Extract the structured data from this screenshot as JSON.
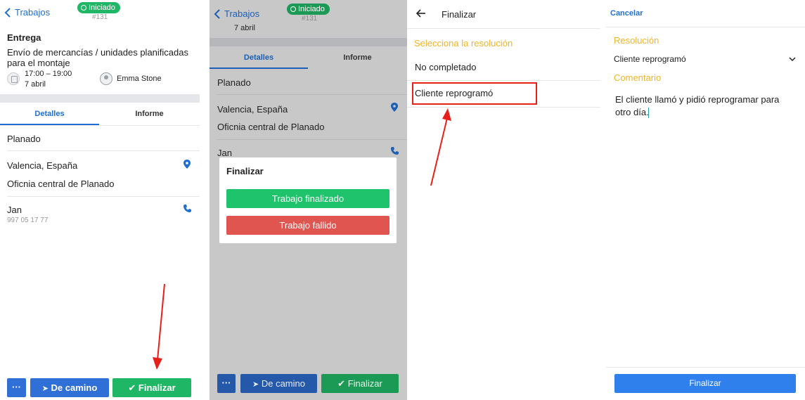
{
  "screen1": {
    "back_label": "Trabajos",
    "status_badge": "Iniciado",
    "job_number": "#131",
    "type_heading": "Entrega",
    "description_line1": "Envío de mercancías / unidades planificadas",
    "description_line2": "para el montaje",
    "time_range": "17:00 – 19:00",
    "date": "7 abril",
    "assignee": "Emma Stone",
    "tabs": [
      {
        "label": "Detalles"
      },
      {
        "label": "Informe"
      }
    ],
    "customer": "Planado",
    "address_city": "Valencia, España",
    "address_place": "Oficnia central de Planado",
    "contact_name": "Jan",
    "contact_phone": "997 05 17 77",
    "buttons": {
      "more": "···",
      "on_the_way": "De camino",
      "finish": "Finalizar"
    },
    "colors": {
      "accent": "#1f6fd1",
      "success": "#1fb765",
      "danger": "#e0554f",
      "annotation": "#e8201a"
    }
  },
  "screen2": {
    "back_label": "Trabajos",
    "status_badge": "Iniciado",
    "job_number": "#131",
    "date_partial": "7 abril",
    "tabs": [
      {
        "label": "Detalles"
      },
      {
        "label": "Informe"
      }
    ],
    "customer": "Planado",
    "address_city": "Valencia, España",
    "address_place": "Oficnia central de Planado",
    "contact_name": "Jan",
    "dialog": {
      "title": "Finalizar",
      "success_button": "Trabajo finalizado",
      "fail_button": "Trabajo fallido"
    },
    "buttons": {
      "more": "···",
      "on_the_way": "De camino",
      "finish": "Finalizar"
    }
  },
  "screen3": {
    "title": "Finalizar",
    "section_label": "Selecciona la resolución",
    "options": [
      {
        "label": "No completado"
      },
      {
        "label": "Cliente reprogramó"
      }
    ]
  },
  "screen4": {
    "cancel_label": "Cancelar",
    "resolution_label": "Resolución",
    "resolution_value": "Cliente reprogramó",
    "comment_label": "Comentario",
    "comment_line1": "El cliente llamó y pidió reprogramar para",
    "comment_line2": "otro día.",
    "submit_label": "Finalizar"
  }
}
